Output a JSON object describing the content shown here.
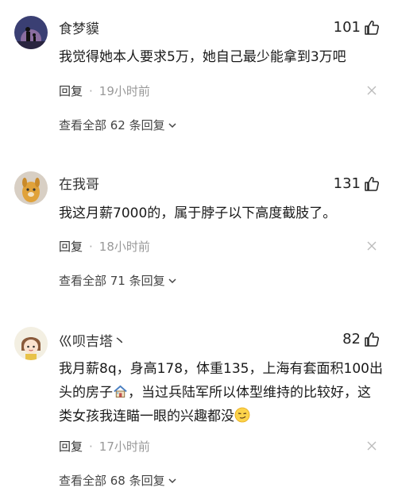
{
  "comments": [
    {
      "username": "食梦貘",
      "likes": "101",
      "text": "我觉得她本人要求5万，她自己最少能拿到3万吧",
      "reply": "回复",
      "dot": "·",
      "time": "19小时前",
      "view_all": "查看全部 62 条回复"
    },
    {
      "username": "在我哥",
      "likes": "131",
      "text": "我这月薪7000的，属于脖子以下高度截肢了。",
      "reply": "回复",
      "dot": "·",
      "time": "18小时前",
      "view_all": "查看全部 71 条回复"
    },
    {
      "username": "巛呗吉塔丶",
      "likes": "82",
      "text_part1": "我月薪8q，身高178，体重135，上海有套面积100出头的房子",
      "text_part2": "，当过兵陆军所以体型维持的比较好，这类女孩我连瞄一眼的兴趣都没",
      "reply": "回复",
      "dot": "·",
      "time": "17小时前",
      "view_all": "查看全部 68 条回复"
    }
  ]
}
